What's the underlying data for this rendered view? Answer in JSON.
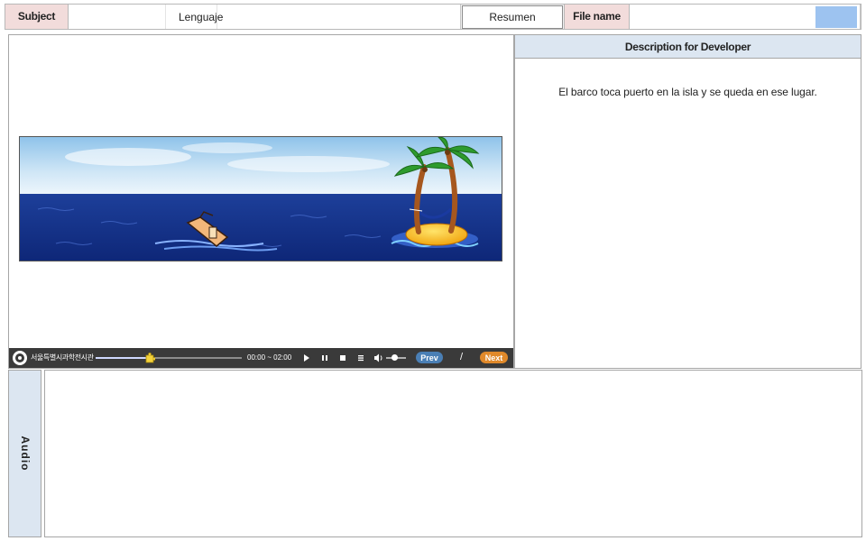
{
  "header": {
    "subject_label": "Subject",
    "subject_value": "Lenguaje",
    "section_value": "Resumen",
    "filename_label": "File name",
    "filename_value": ""
  },
  "description": {
    "title": "Description for Developer",
    "text": "El barco toca puerto en la isla y se queda en ese lugar."
  },
  "player": {
    "brand": "서울특별시과학전시관",
    "time": "00:00 ~ 02:00",
    "prev_label": "Prev",
    "separator": "/",
    "next_label": "Next",
    "progress": 0.37,
    "volume": 0.45
  },
  "audio": {
    "label": "Audio"
  },
  "colors": {
    "label_pink": "#f2dcdb",
    "panel_blue": "#dce6f1",
    "player_bg": "#3a3a3a",
    "prev_blue": "#4a7fb5",
    "next_orange": "#e0892a",
    "swatch": "#9dc3f0"
  }
}
